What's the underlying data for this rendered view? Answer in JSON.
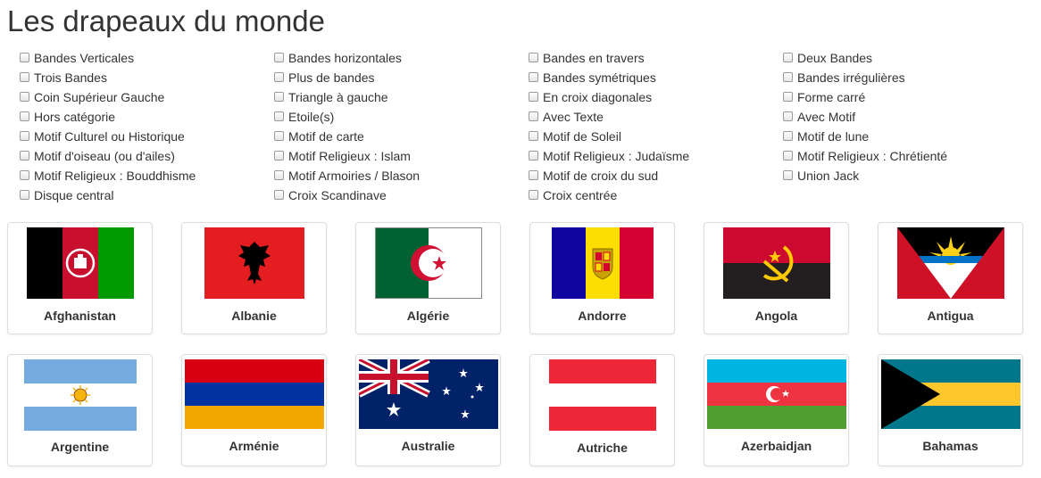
{
  "title": "Les drapeaux du monde",
  "filters": [
    "Bandes Verticales",
    "Bandes horizontales",
    "Bandes en travers",
    "Deux Bandes",
    "Trois Bandes",
    "Plus de bandes",
    "Bandes symétriques",
    "Bandes irrégulières",
    "Coin Supérieur Gauche",
    "Triangle à gauche",
    "En croix diagonales",
    "Forme carré",
    "Hors catégorie",
    "Etoile(s)",
    "Avec Texte",
    "Avec Motif",
    "Motif Culturel ou Historique",
    "Motif de carte",
    "Motif de Soleil",
    "Motif de lune",
    "Motif d'oiseau (ou d'ailes)",
    "Motif Religieux : Islam",
    "Motif Religieux : Judaïsme",
    "Motif Religieux : Chrétienté",
    "Motif Religieux : Bouddhisme",
    "Motif Armoiries / Blason",
    "Motif de croix du sud",
    "Union Jack",
    "Disque central",
    "Croix Scandinave",
    "Croix centrée",
    ""
  ],
  "countries": [
    {
      "name": "Afghanistan",
      "flag": "afghanistan-flag"
    },
    {
      "name": "Albanie",
      "flag": "albania-flag"
    },
    {
      "name": "Algérie",
      "flag": "algeria-flag"
    },
    {
      "name": "Andorre",
      "flag": "andorra-flag"
    },
    {
      "name": "Angola",
      "flag": "angola-flag"
    },
    {
      "name": "Antigua",
      "flag": "antigua-flag"
    },
    {
      "name": "Argentine",
      "flag": "argentina-flag"
    },
    {
      "name": "Arménie",
      "flag": "armenia-flag"
    },
    {
      "name": "Australie",
      "flag": "australia-flag"
    },
    {
      "name": "Autriche",
      "flag": "austria-flag"
    },
    {
      "name": "Azerbaidjan",
      "flag": "azerbaijan-flag"
    },
    {
      "name": "Bahamas",
      "flag": "bahamas-flag"
    }
  ]
}
